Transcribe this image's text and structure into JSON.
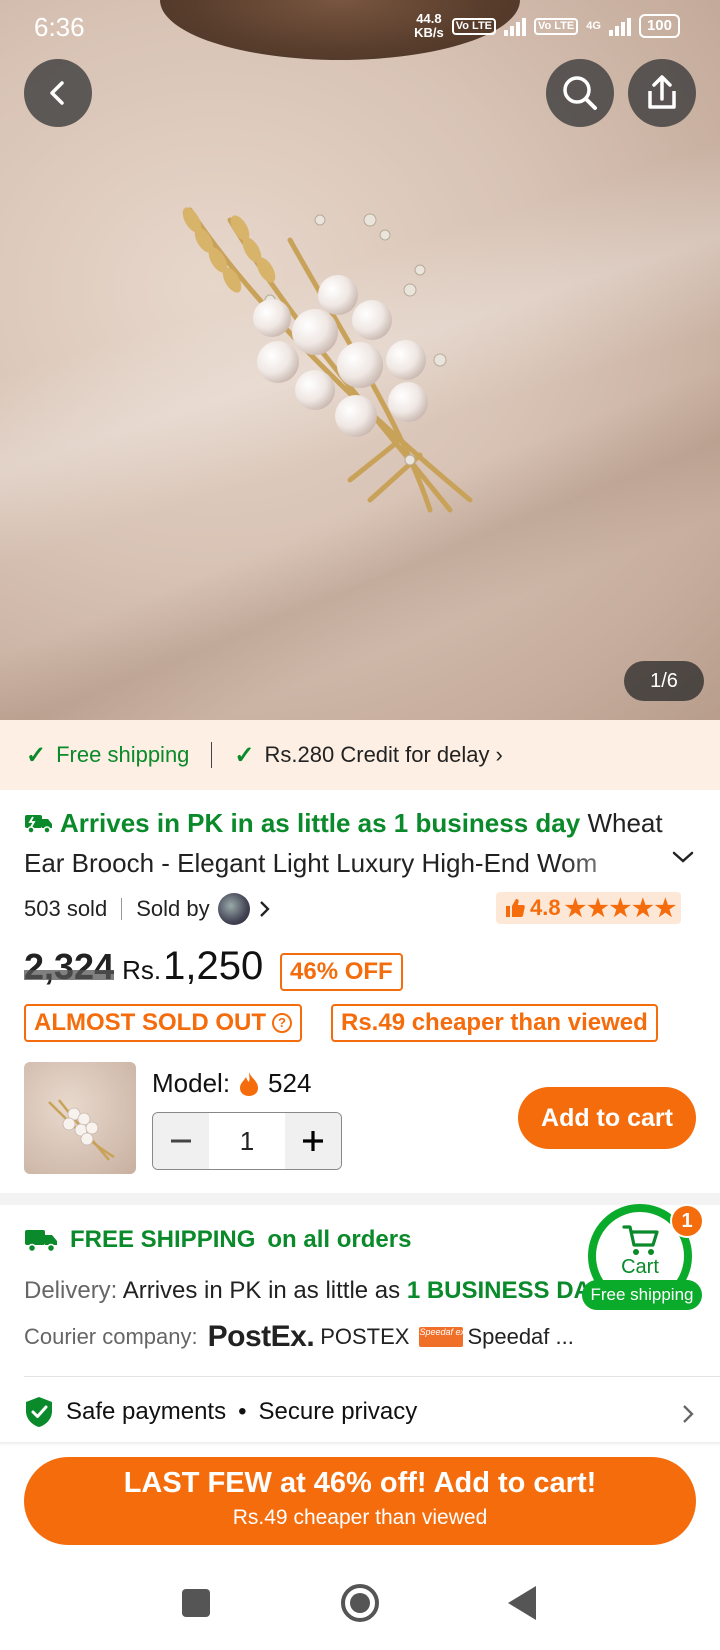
{
  "status_bar": {
    "time": "6:36",
    "speed_value": "44.8",
    "speed_unit": "KB/s",
    "sim1": "Vo LTE",
    "sim2": "Vo LTE",
    "network": "4G",
    "battery": "100"
  },
  "gallery": {
    "counter": "1/6"
  },
  "shipping_strip": {
    "free_shipping": "Free shipping",
    "credit": "Rs.280 Credit for delay"
  },
  "product": {
    "arrival": "Arrives in PK in as little as 1 business day",
    "title": "Wheat Ear Brooch - Elegant Light Luxury High-End Wom",
    "sold": "503 sold",
    "sold_by": "Sold by",
    "rating": "4.8",
    "stars": "★★★★★",
    "old_price": "2,324",
    "currency": "Rs.",
    "price": "1,250",
    "discount": "46% OFF",
    "almost_sold_out": "ALMOST SOLD OUT",
    "cheaper": "Rs.49 cheaper than viewed",
    "model_label": "Model:",
    "model_count": "524",
    "quantity": "1",
    "add_to_cart": "Add to cart"
  },
  "shipping_info": {
    "free_shipping_bold": "FREE SHIPPING",
    "free_shipping_rest": "on all orders",
    "delivery_label": "Delivery:",
    "delivery_text": "Arrives in PK in as little as",
    "delivery_bold": "1 BUSINESS DA",
    "courier_label": "Courier company:",
    "postex_logo": "PostEx.",
    "postex": "POSTEX",
    "speedaf_logo": "Speedaf express",
    "speedaf": "Speedaf ..."
  },
  "cart_float": {
    "badge": "1",
    "label": "Cart",
    "free_shipping": "Free shipping"
  },
  "safe": {
    "text": "Safe payments",
    "dot": "•",
    "privacy": "Secure privacy"
  },
  "cta": {
    "line1": "LAST FEW at 46% off! Add to cart!",
    "line2": "Rs.49 cheaper than viewed"
  },
  "colors": {
    "accent": "#f56c0c",
    "green": "#0a8a2a",
    "strip_bg": "#fdefe3"
  }
}
